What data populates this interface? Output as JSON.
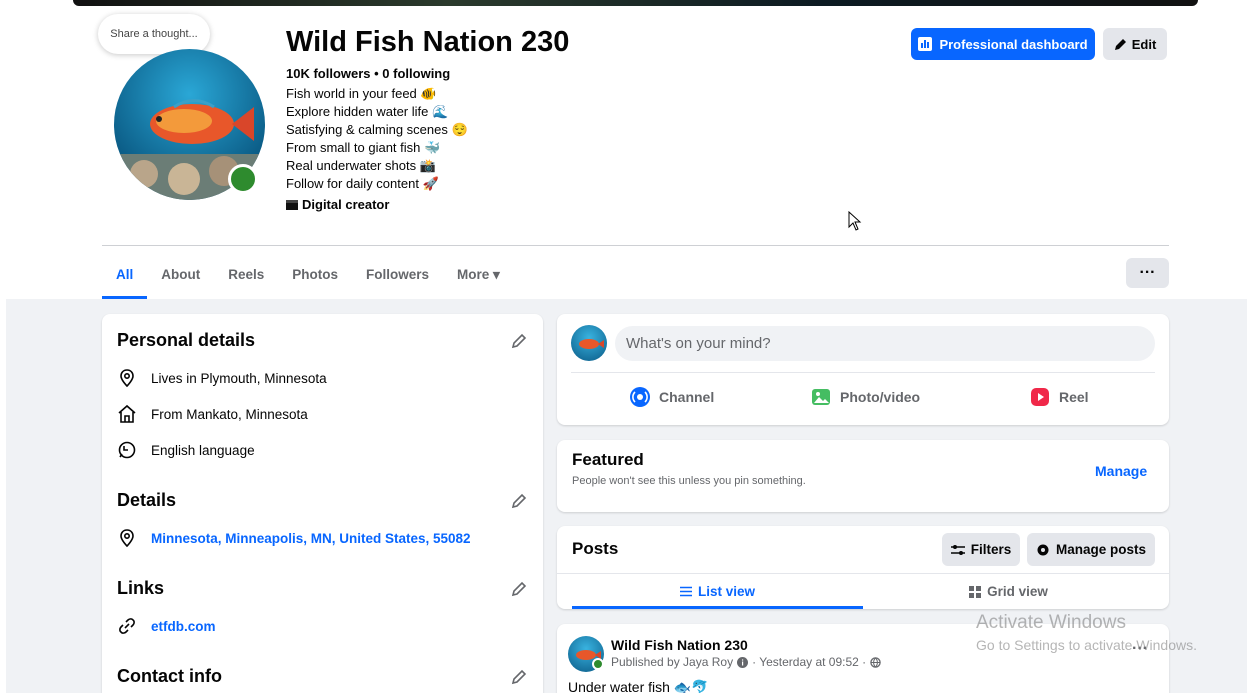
{
  "profile": {
    "thought_bubble": "Share a thought...",
    "name": "Wild Fish Nation 230",
    "followers_line": "10K followers • 0 following",
    "bio": [
      "Fish world in your feed 🐠",
      "Explore hidden water life 🌊",
      "Satisfying & calming scenes 😌",
      "From small to giant fish 🐳",
      "Real underwater shots 📸",
      "Follow for daily content 🚀"
    ],
    "category": "Digital creator"
  },
  "header_buttons": {
    "professional_dashboard": "Professional dashboard",
    "edit": "Edit"
  },
  "tabs": [
    {
      "label": "All",
      "active": true
    },
    {
      "label": "About"
    },
    {
      "label": "Reels"
    },
    {
      "label": "Photos"
    },
    {
      "label": "Followers"
    },
    {
      "label": "More ▾"
    }
  ],
  "more_menu_label": "···",
  "personal_details": {
    "title": "Personal details",
    "items": [
      {
        "icon": "location-pin-icon",
        "text": "Lives in Plymouth, Minnesota"
      },
      {
        "icon": "home-icon",
        "text": "From Mankato, Minnesota"
      },
      {
        "icon": "language-icon",
        "text": "English language"
      }
    ]
  },
  "details": {
    "title": "Details",
    "location_link": "Minnesota, Minneapolis, MN, United States, 55082"
  },
  "links": {
    "title": "Links",
    "website": "etfdb.com"
  },
  "contact_info": {
    "title": "Contact info"
  },
  "composer": {
    "placeholder": "What's on your mind?",
    "actions": [
      "Channel",
      "Photo/video",
      "Reel"
    ]
  },
  "featured": {
    "title": "Featured",
    "subtitle": "People won't see this unless you pin something.",
    "manage": "Manage"
  },
  "posts": {
    "title": "Posts",
    "filters": "Filters",
    "manage_posts": "Manage posts",
    "list_view": "List view",
    "grid_view": "Grid view"
  },
  "post": {
    "author": "Wild Fish Nation 230",
    "published_by": "Published by Jaya Roy",
    "time": "· Yesterday at 09:52 ·",
    "text": "Under water fish 🐟🐬",
    "menu": "···"
  },
  "watermark": {
    "line1": "Activate Windows",
    "line2": "Go to Settings to activate Windows."
  },
  "colors": {
    "accent": "#0866ff",
    "online": "#2e8b2e",
    "page_bg": "#f0f2f5"
  }
}
